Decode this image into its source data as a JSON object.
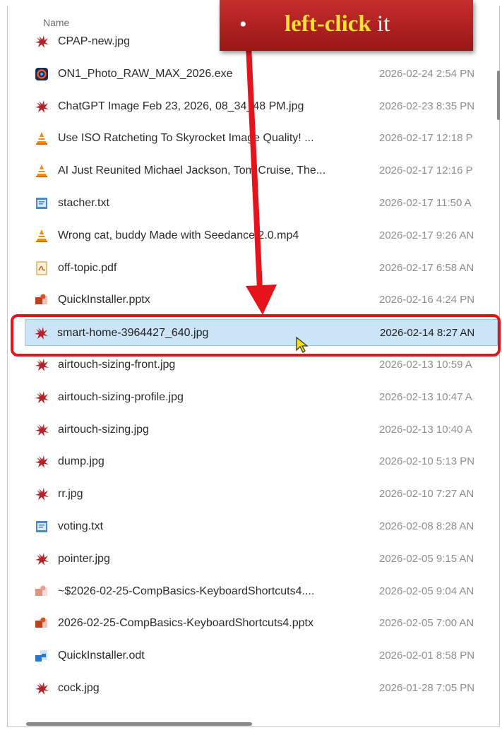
{
  "list": {
    "column_name_header": "Name",
    "rows": [
      {
        "name": "CPAP-new.jpg",
        "date": "",
        "icon": "jpg-image-icon"
      },
      {
        "name": "ON1_Photo_RAW_MAX_2026.exe",
        "date": "2026-02-24 2:54 PN",
        "icon": "exe-app-icon"
      },
      {
        "name": "ChatGPT Image Feb 23, 2026, 08_34_48 PM.jpg",
        "date": "2026-02-23 8:35 PN",
        "icon": "jpg-image-icon"
      },
      {
        "name": "Use ISO Ratcheting To Skyrocket Image Quality! ...",
        "date": "2026-02-17 12:18 P",
        "icon": "vlc-video-icon"
      },
      {
        "name": "AI Just Reunited Michael Jackson, Tom Cruise, The...",
        "date": "2026-02-17 12:16 P",
        "icon": "vlc-video-icon"
      },
      {
        "name": "stacher.txt",
        "date": "2026-02-17 11:50 A",
        "icon": "txt-file-icon"
      },
      {
        "name": "Wrong cat, buddy Made with Seedance 2.0.mp4",
        "date": "2026-02-17 9:26 AN",
        "icon": "vlc-video-icon"
      },
      {
        "name": "off-topic.pdf",
        "date": "2026-02-17 6:58 AN",
        "icon": "pdf-file-icon"
      },
      {
        "name": "QuickInstaller.pptx",
        "date": "2026-02-16 4:24 PN",
        "icon": "pptx-file-icon"
      },
      {
        "name": "smart-home-3964427_640.jpg",
        "date": "2026-02-14 8:27 AN",
        "icon": "jpg-image-icon"
      },
      {
        "name": "airtouch-sizing-front.jpg",
        "date": "2026-02-13 10:59 A",
        "icon": "jpg-image-icon"
      },
      {
        "name": "airtouch-sizing-profile.jpg",
        "date": "2026-02-13 10:47 A",
        "icon": "jpg-image-icon"
      },
      {
        "name": "airtouch-sizing.jpg",
        "date": "2026-02-13 10:40 A",
        "icon": "jpg-image-icon"
      },
      {
        "name": "dump.jpg",
        "date": "2026-02-10 5:13 PN",
        "icon": "jpg-image-icon"
      },
      {
        "name": "rr.jpg",
        "date": "2026-02-10 7:27 AN",
        "icon": "jpg-image-icon"
      },
      {
        "name": "voting.txt",
        "date": "2026-02-08 8:28 AN",
        "icon": "txt-file-icon"
      },
      {
        "name": "pointer.jpg",
        "date": "2026-02-05 9:15 AN",
        "icon": "jpg-image-icon"
      },
      {
        "name": "~$2026-02-25-CompBasics-KeyboardShortcuts4....",
        "date": "2026-02-05 9:04 AN",
        "icon": "pptx-temp-file-icon"
      },
      {
        "name": "2026-02-25-CompBasics-KeyboardShortcuts4.pptx",
        "date": "2026-02-05 7:00 AN",
        "icon": "pptx-file-icon"
      },
      {
        "name": "QuickInstaller.odt",
        "date": "2026-02-01 8:58 PN",
        "icon": "odt-file-icon"
      },
      {
        "name": "cock.jpg",
        "date": "2026-01-28 7:05 PN",
        "icon": "jpg-image-icon"
      }
    ],
    "selected_index": 9
  },
  "callout": {
    "bullet": "•",
    "keyword": "left-click",
    "rest": " it"
  },
  "colors": {
    "callout_bg": "#b42020",
    "keyword": "#ffe135",
    "highlight": "#e5141c",
    "selection": "#cce4f7"
  }
}
